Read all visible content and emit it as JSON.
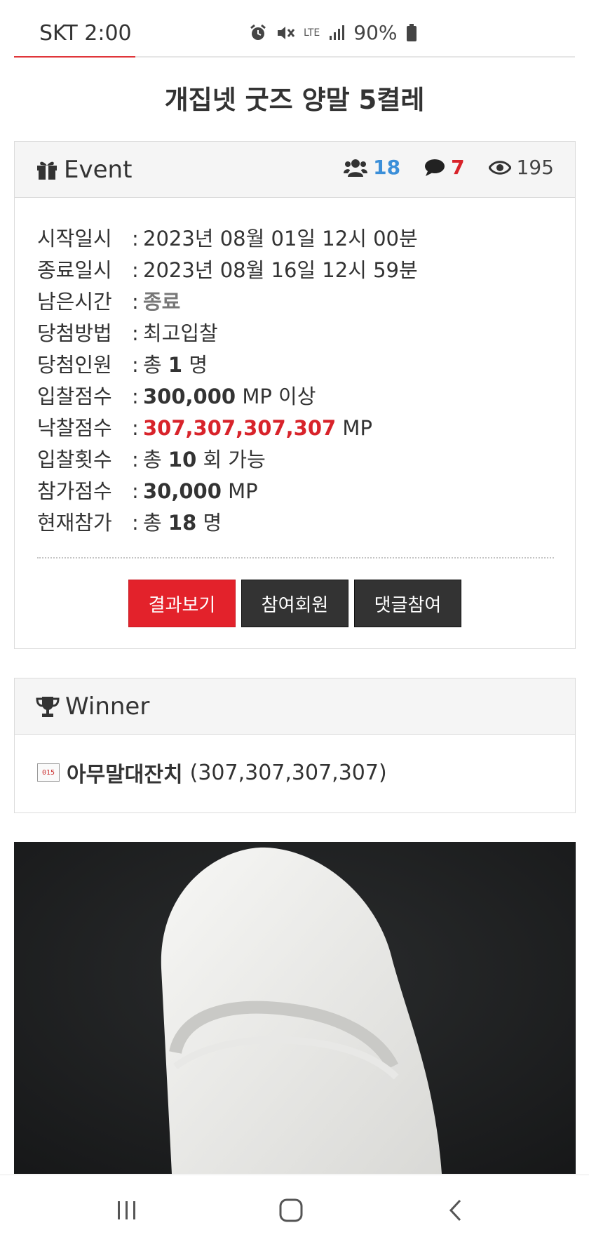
{
  "status_bar": {
    "carrier_time": "SKT 2:00",
    "network": "LTE",
    "battery": "90%",
    "icons": [
      "alarm-icon",
      "mute-icon",
      "lte-icon",
      "signal-icon",
      "battery-icon"
    ]
  },
  "page": {
    "title": "개집넷 굿즈 양말 5켤레"
  },
  "event": {
    "header_label": "Event",
    "participants_count": "18",
    "comments_count": "7",
    "views_count": "195",
    "rows": [
      {
        "label": "시작일시",
        "sep": ":",
        "value": "2023년 08월 01일 12시 00분"
      },
      {
        "label": "종료일시",
        "sep": ":",
        "value": "2023년 08월 16일 12시 59분"
      },
      {
        "label": "남은시간",
        "sep": ":",
        "value": "종료"
      },
      {
        "label": "당첨방법",
        "sep": ":",
        "value": "최고입찰"
      },
      {
        "label": "당첨인원",
        "sep": ":",
        "pre": "총",
        "value": "1",
        "post": "명"
      },
      {
        "label": "입찰점수",
        "sep": ":",
        "value": "300,000",
        "post": "MP 이상"
      },
      {
        "label": "낙찰점수",
        "sep": ":",
        "value": "307,307,307,307",
        "post": "MP"
      },
      {
        "label": "입찰횟수",
        "sep": ":",
        "pre": "총",
        "value": "10",
        "post": "회 가능"
      },
      {
        "label": "참가점수",
        "sep": ":",
        "value": "30,000",
        "post": "MP"
      },
      {
        "label": "현재참가",
        "sep": ":",
        "pre": "총",
        "value": "18",
        "post": "명"
      }
    ],
    "buttons": {
      "result": "결과보기",
      "participants": "참여회원",
      "comment": "댓글참여"
    }
  },
  "winner": {
    "header_label": "Winner",
    "badge_text": "015",
    "name": "아무말대잔치",
    "score": "(307,307,307,307)"
  },
  "colors": {
    "accent_red": "#e3222b",
    "count_blue": "#3b8fd9",
    "dark_button": "#333333"
  }
}
